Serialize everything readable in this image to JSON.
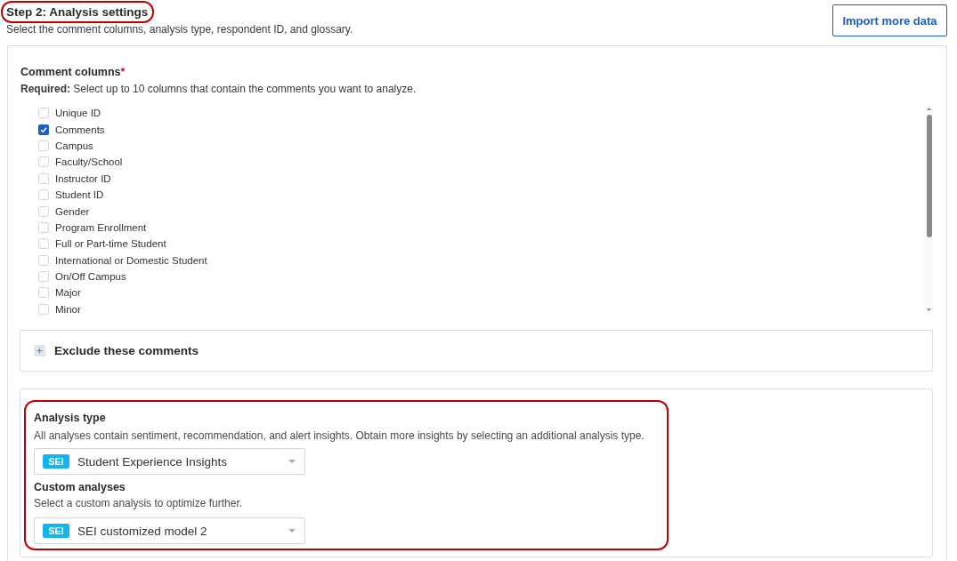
{
  "header": {
    "title": "Step 2: Analysis settings",
    "highlighted": true,
    "subtitle": "Select the comment columns, analysis type, respondent ID, and glossary.",
    "import_button": "Import more data"
  },
  "comment_columns": {
    "label": "Comment columns",
    "required_mark": "*",
    "hint": "**Required:** Select up to 10 columns that contain the comments you want to analyze.",
    "columns": [
      {
        "label": "Unique ID",
        "checked": false
      },
      {
        "label": "Comments",
        "checked": true
      },
      {
        "label": "Campus",
        "checked": false
      },
      {
        "label": "Faculty/School",
        "checked": false
      },
      {
        "label": "Instructor ID",
        "checked": false
      },
      {
        "label": "Student ID",
        "checked": false
      },
      {
        "label": "Gender",
        "checked": false
      },
      {
        "label": "Program Enrollment",
        "checked": false
      },
      {
        "label": "Full or Part-time Student",
        "checked": false
      },
      {
        "label": "International or Domestic Student",
        "checked": false
      },
      {
        "label": "On/Off Campus",
        "checked": false
      },
      {
        "label": "Major",
        "checked": false
      },
      {
        "label": "Minor",
        "checked": false
      }
    ]
  },
  "exclude_section": {
    "title": "Exclude these comments",
    "expanded": false
  },
  "analysis": {
    "highlighted": true,
    "fields": [
      {
        "label": "Analysis type",
        "description": "All analyses contain sentiment, recommendation, and alert insights. Obtain more insights by selecting an additional analysis type.",
        "dropdown": {
          "tag": "SEI",
          "value": "Student Experience Insights"
        }
      },
      {
        "label": "Custom analyses",
        "description": "Select a custom analysis to optimize further.",
        "dropdown": {
          "tag": "SEI",
          "value": "SEI customized model 2"
        }
      }
    ]
  }
}
